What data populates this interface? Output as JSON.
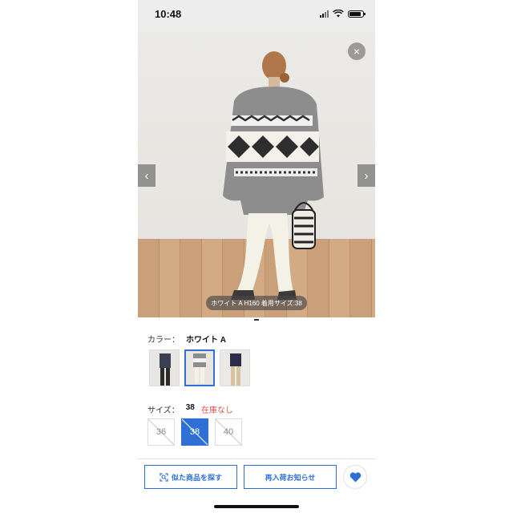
{
  "status_bar": {
    "time": "10:48"
  },
  "gallery": {
    "caption": "ホワイト A H160 着用サイズ:38",
    "close_glyph": "×",
    "prev_glyph": "‹",
    "next_glyph": "›"
  },
  "color": {
    "label": "カラー：",
    "value": "ホワイト A",
    "swatches": [
      {
        "name": "swatch-1",
        "selected": false
      },
      {
        "name": "swatch-2",
        "selected": true
      },
      {
        "name": "swatch-3",
        "selected": false
      }
    ]
  },
  "size": {
    "label": "サイズ：",
    "value": "38",
    "stock": "在庫なし",
    "options": [
      "36",
      "38",
      "40"
    ]
  },
  "actions": {
    "similar": "似た商品を探す",
    "restock": "再入荷お知らせ"
  },
  "colors": {
    "accent": "#2f6fd6",
    "stock_warning": "#d9534f"
  }
}
